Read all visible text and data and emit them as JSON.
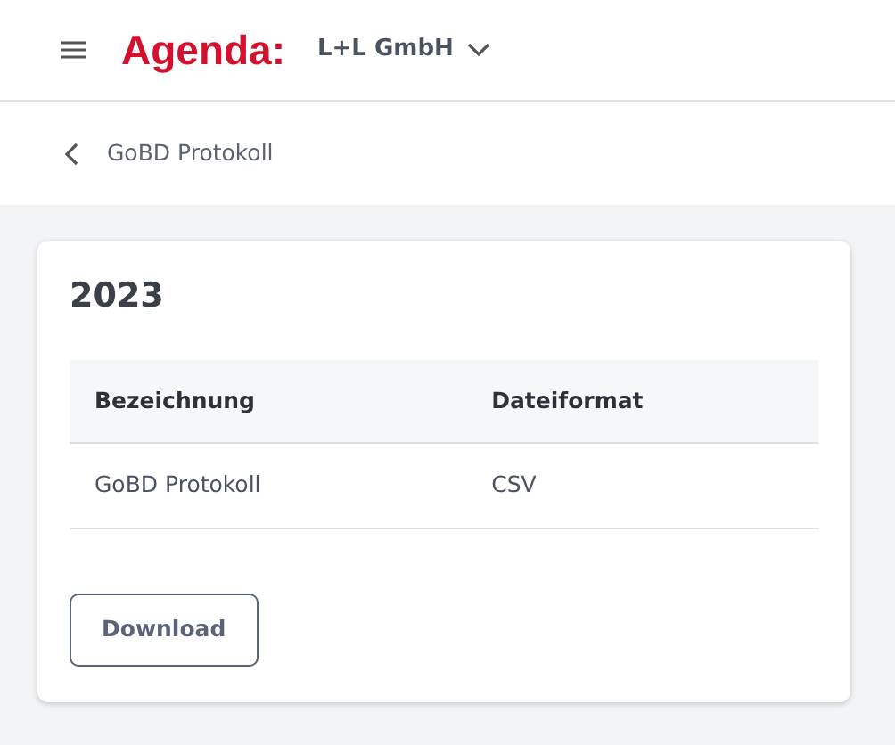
{
  "header": {
    "logo": "Agenda:",
    "company": "L+L GmbH"
  },
  "breadcrumb": {
    "title": "GoBD Protokoll"
  },
  "card": {
    "title": "2023",
    "table": {
      "columns": [
        "Bezeichnung",
        "Dateiformat"
      ],
      "rows": [
        [
          "GoBD Protokoll",
          "CSV"
        ]
      ]
    },
    "button": "Download"
  }
}
